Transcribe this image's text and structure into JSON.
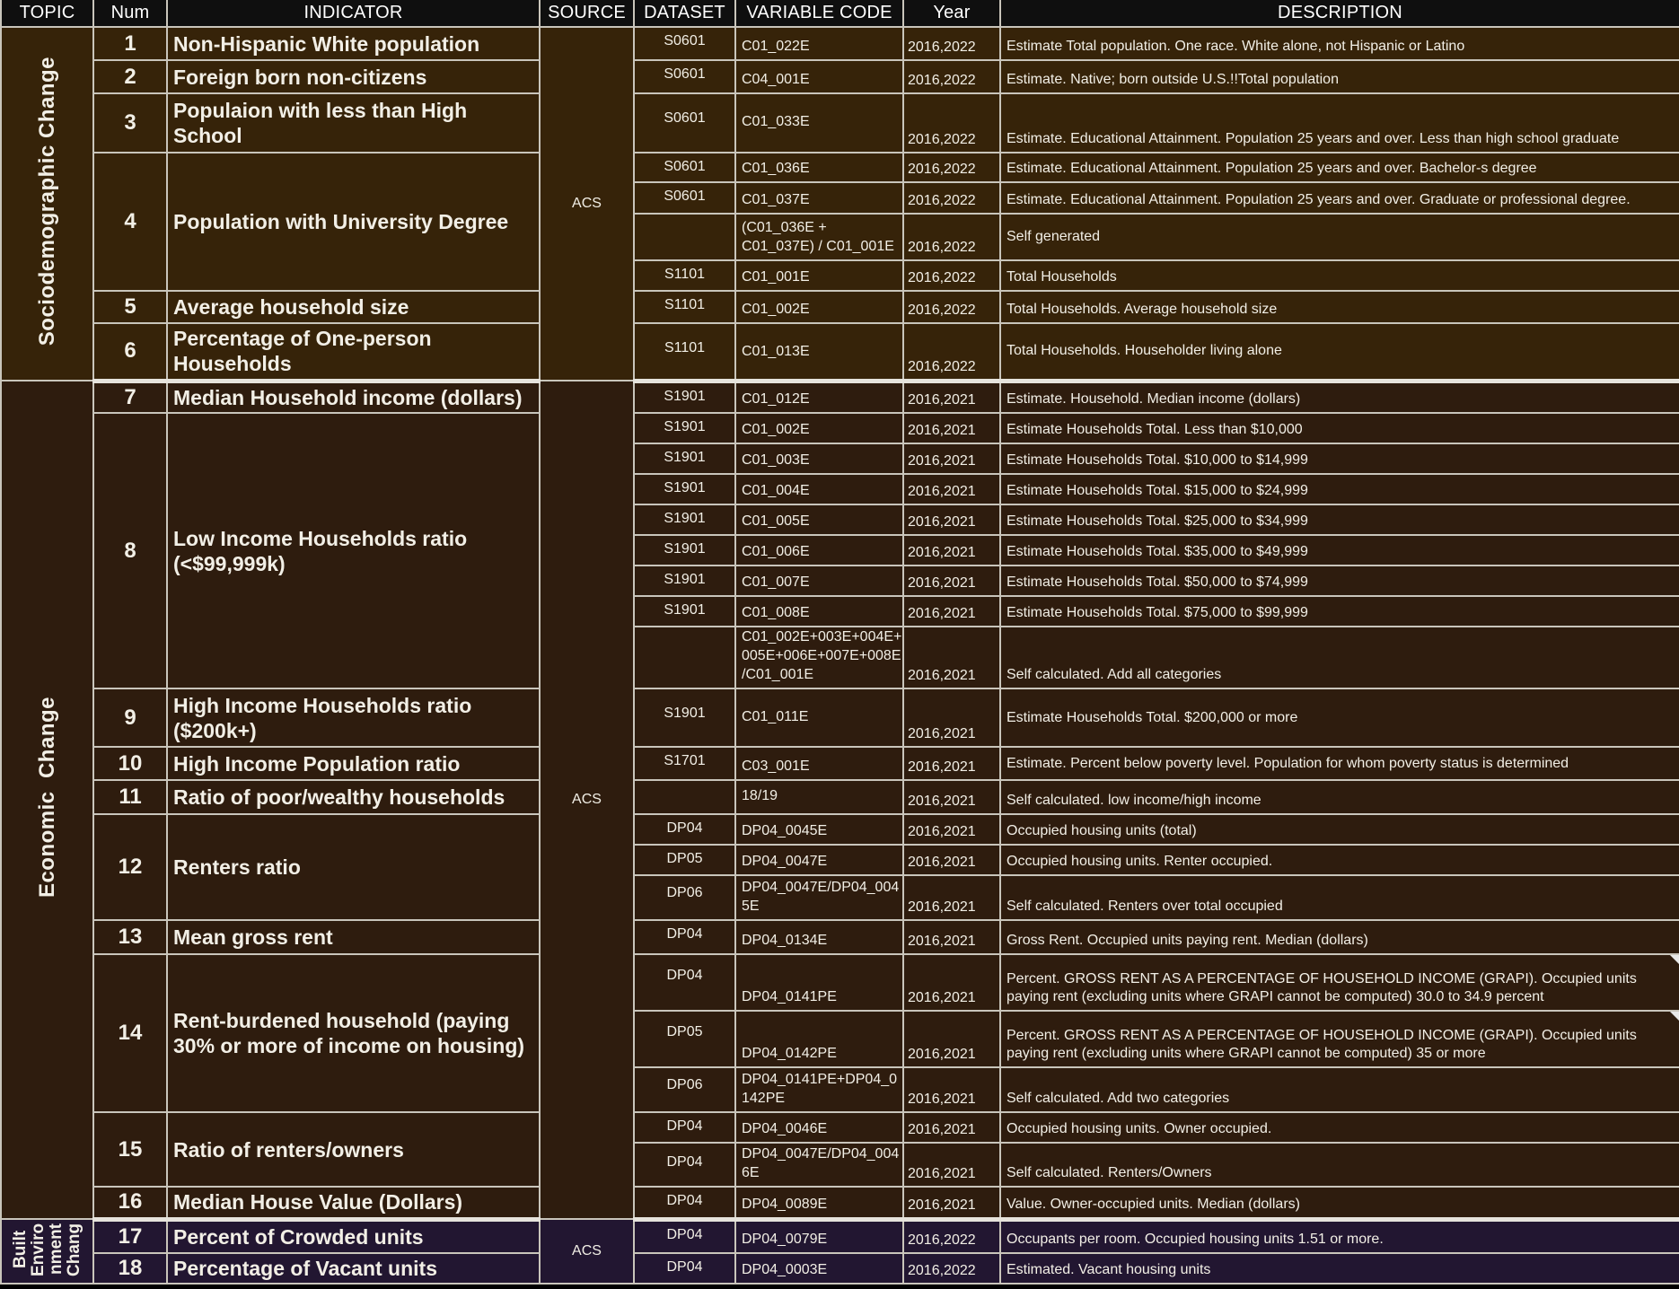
{
  "columns": [
    "TOPIC",
    "Num",
    "INDICATOR",
    "SOURCE",
    "DATASET",
    "VARIABLE CODE",
    "Year",
    "DESCRIPTION"
  ],
  "colors": {
    "header_bg": "#0f0f0f",
    "sociodemographic_bg": "#362309",
    "economic_bg": "#2e1c0e",
    "built_env_bg": "#221631",
    "border": "#c9c5bb",
    "text": "#f2efe6"
  },
  "topics": [
    {
      "label": "Sociodemographic Change"
    },
    {
      "label": "Economic  Change"
    },
    {
      "label": "Built Enviro nment Chang"
    }
  ],
  "sources": [
    "ACS",
    "ACS",
    "ACS"
  ],
  "indicators": {
    "1": {
      "num": "1",
      "label": "Non-Hispanic White population"
    },
    "2": {
      "num": "2",
      "label": "Foreign born non-citizens"
    },
    "3": {
      "num": "3",
      "label": "Populaion with less than High School"
    },
    "4": {
      "num": "4",
      "label": "Population with University Degree"
    },
    "5": {
      "num": "5",
      "label": "Average household size"
    },
    "6": {
      "num": "6",
      "label": "Percentage of One-person Households"
    },
    "7": {
      "num": "7",
      "label": "Median Household income (dollars)"
    },
    "8": {
      "num": "8",
      "label": "Low Income Households ratio (<$99,999k)"
    },
    "9": {
      "num": "9",
      "label": "High Income Households ratio ($200k+)"
    },
    "10": {
      "num": "10",
      "label": "High Income Population ratio"
    },
    "11": {
      "num": "11",
      "label": "Ratio of poor/wealthy households"
    },
    "12": {
      "num": "12",
      "label": "Renters ratio"
    },
    "13": {
      "num": "13",
      "label": "Mean gross rent"
    },
    "14": {
      "num": "14",
      "label": "Rent-burdened household (paying 30% or more of income on housing)"
    },
    "15": {
      "num": "15",
      "label": "Ratio of renters/owners"
    },
    "16": {
      "num": "16",
      "label": "Median House Value (Dollars)"
    },
    "17": {
      "num": "17",
      "label": "Percent of Crowded units"
    },
    "18": {
      "num": "18",
      "label": "Percentage of Vacant units"
    }
  },
  "rows": [
    {
      "dataset": "S0601",
      "code": "C01_022E",
      "year": "2016,2022",
      "desc": "Estimate Total population. One race. White alone, not Hispanic or Latino"
    },
    {
      "dataset": "S0601",
      "code": "C04_001E",
      "year": "2016,2022",
      "desc": "Estimate. Native; born outside U.S.!!Total population"
    },
    {
      "dataset": "S0601",
      "code": "C01_033E",
      "year": "2016,2022",
      "desc": "Estimate. Educational Attainment. Population 25 years and over. Less than high school graduate"
    },
    {
      "dataset": "S0601",
      "code": "C01_036E",
      "year": "2016,2022",
      "desc": "Estimate. Educational Attainment. Population 25 years and over. Bachelor-s degree"
    },
    {
      "dataset": "S0601",
      "code": "C01_037E",
      "year": "2016,2022",
      "desc": "Estimate. Educational Attainment. Population 25 years and over. Graduate or professional degree."
    },
    {
      "dataset": "",
      "code": "(C01_036E + C01_037E) /  C01_001E",
      "year": "2016,2022",
      "desc": "Self generated"
    },
    {
      "dataset": "S1101",
      "code": "C01_001E",
      "year": "2016,2022",
      "desc": "Total Households"
    },
    {
      "dataset": "S1101",
      "code": "C01_002E",
      "year": "2016,2022",
      "desc": "Total Households. Average household size"
    },
    {
      "dataset": "S1101",
      "code": "C01_013E",
      "year": "2016,2022",
      "desc": "Total Households. Householder living alone"
    },
    {
      "dataset": "S1901",
      "code": "C01_012E",
      "year": "2016,2021",
      "desc": "Estimate. Household. Median income (dollars)"
    },
    {
      "dataset": "S1901",
      "code": "C01_002E",
      "year": "2016,2021",
      "desc": "Estimate Households Total. Less than $10,000"
    },
    {
      "dataset": "S1901",
      "code": "C01_003E",
      "year": "2016,2021",
      "desc": "Estimate Households Total. $10,000 to $14,999"
    },
    {
      "dataset": "S1901",
      "code": "C01_004E",
      "year": "2016,2021",
      "desc": "Estimate Households Total. $15,000 to $24,999"
    },
    {
      "dataset": "S1901",
      "code": "C01_005E",
      "year": "2016,2021",
      "desc": "Estimate Households Total. $25,000 to $34,999"
    },
    {
      "dataset": "S1901",
      "code": "C01_006E",
      "year": "2016,2021",
      "desc": "Estimate Households Total. $35,000 to $49,999"
    },
    {
      "dataset": "S1901",
      "code": "C01_007E",
      "year": "2016,2021",
      "desc": "Estimate Households Total. $50,000 to $74,999"
    },
    {
      "dataset": "S1901",
      "code": "C01_008E",
      "year": "2016,2021",
      "desc": "Estimate Households Total. $75,000 to $99,999"
    },
    {
      "dataset": "",
      "code": "C01_002E+003E+004E+ 005E+006E+007E+008E /C01_001E",
      "year": "2016,2021",
      "desc": "Self calculated. Add all categories"
    },
    {
      "dataset": "S1901",
      "code": "C01_011E",
      "year": "2016,2021",
      "desc": "Estimate Households Total. $200,000 or more"
    },
    {
      "dataset": "S1701",
      "code": "C03_001E",
      "year": "2016,2021",
      "desc": "Estimate. Percent below poverty level. Population for whom poverty status is determined"
    },
    {
      "dataset": "",
      "code": "18/19",
      "year": "2016,2021",
      "desc": "Self calculated. low income/high income"
    },
    {
      "dataset": "DP04",
      "code": "DP04_0045E",
      "year": "2016,2021",
      "desc": "Occupied housing units (total)"
    },
    {
      "dataset": "DP05",
      "code": "DP04_0047E",
      "year": "2016,2021",
      "desc": "Occupied housing units. Renter occupied."
    },
    {
      "dataset": "DP06",
      "code": "DP04_0047E/DP04_004 5E",
      "year": "2016,2021",
      "desc": "Self calculated. Renters over total occupied"
    },
    {
      "dataset": "DP04",
      "code": "DP04_0134E",
      "year": "2016,2021",
      "desc": "Gross Rent. Occupied units paying rent. Median (dollars)"
    },
    {
      "dataset": "DP04",
      "code": "DP04_0141PE",
      "year": "2016,2021",
      "desc": "Percent. GROSS RENT AS A PERCENTAGE OF HOUSEHOLD INCOME (GRAPI). Occupied units paying rent (excluding units where GRAPI cannot be computed) 30.0 to 34.9 percent"
    },
    {
      "dataset": "DP05",
      "code": "DP04_0142PE",
      "year": "2016,2021",
      "desc": "Percent. GROSS RENT AS A PERCENTAGE OF HOUSEHOLD INCOME (GRAPI). Occupied units paying rent (excluding units where GRAPI cannot be computed) 35 or more"
    },
    {
      "dataset": "DP06",
      "code": "DP04_0141PE+DP04_0 142PE",
      "year": "2016,2021",
      "desc": "Self calculated. Add two categories"
    },
    {
      "dataset": "DP04",
      "code": "DP04_0046E",
      "year": "2016,2021",
      "desc": "Occupied housing units. Owner occupied."
    },
    {
      "dataset": "DP04",
      "code": "DP04_0047E/DP04_004 6E",
      "year": "2016,2021",
      "desc": "Self calculated. Renters/Owners"
    },
    {
      "dataset": "DP04",
      "code": "DP04_0089E",
      "year": "2016,2021",
      "desc": "Value. Owner-occupied units. Median (dollars)"
    },
    {
      "dataset": "DP04",
      "code": "DP04_0079E",
      "year": "2016,2022",
      "desc": "Occupants per room. Occupied housing units 1.51 or more."
    },
    {
      "dataset": "DP04",
      "code": "DP04_0003E",
      "year": "2016,2022",
      "desc": "Estimated. Vacant housing units"
    }
  ]
}
